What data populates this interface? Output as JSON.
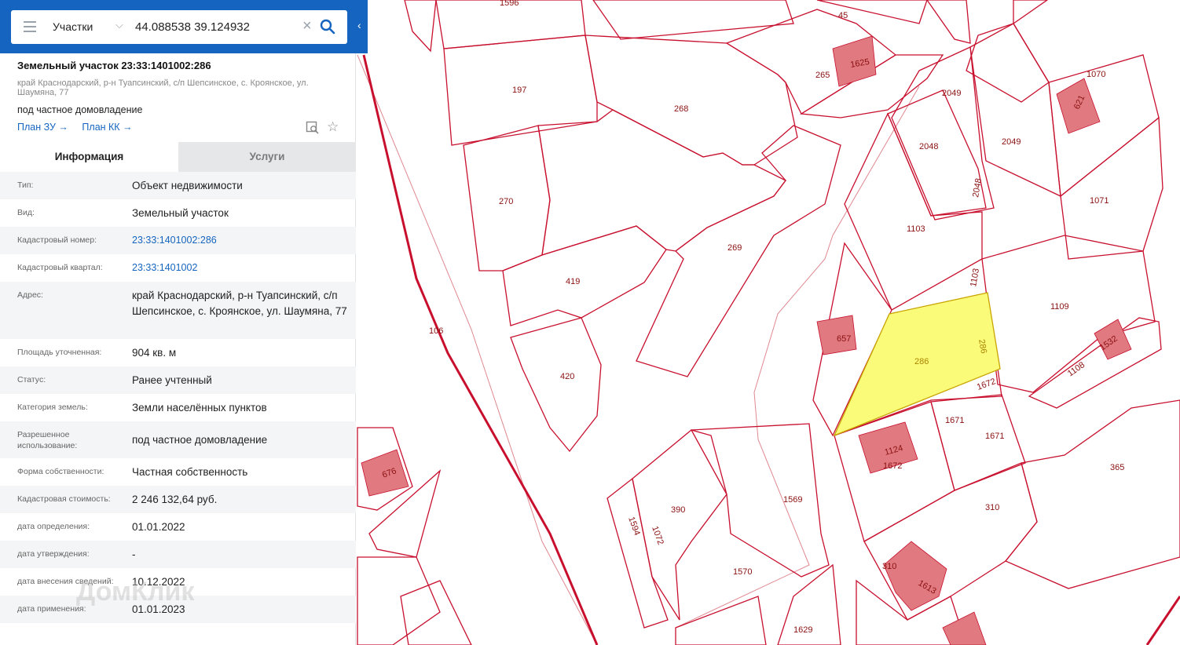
{
  "search": {
    "type": "Участки",
    "query": "44.088538 39.124932"
  },
  "object": {
    "title": "Земельный участок 23:33:1401002:286",
    "address": "край Краснодарский, р-н Туапсинский, с/п Шепсинское, с. Кроянское, ул. Шаумяна, 77",
    "purpose": "под частное домовладение",
    "links": [
      "План ЗУ →",
      "План КК →"
    ]
  },
  "tabs": [
    "Информация",
    "Услуги"
  ],
  "info": [
    {
      "key": "Тип:",
      "value": "Объект недвижимости"
    },
    {
      "key": "Вид:",
      "value": "Земельный участок"
    },
    {
      "key": "Кадастровый номер:",
      "value": "23:33:1401002:286"
    },
    {
      "key": "Кадастровый квартал:",
      "value": "23:33:1401002"
    },
    {
      "key": "Адрес:",
      "value": "край Краснодарский, р-н Туапсинский, с/п Шепсинское, с. Кроянское, ул. Шаумяна, 77"
    },
    {
      "key": "Площадь уточненная:",
      "value": "904 кв. м"
    },
    {
      "key": "Статус:",
      "value": "Ранее учтенный"
    },
    {
      "key": "Категория земель:",
      "value": "Земли населённых пунктов"
    },
    {
      "key": "Разрешенное использование:",
      "value": "под частное домовладение"
    },
    {
      "key": "Форма собственности:",
      "value": "Частная собственность"
    },
    {
      "key": "Кадастровая стоимость:",
      "value": "2 246 132,64 руб."
    },
    {
      "key": "дата определения:",
      "value": "01.01.2022"
    },
    {
      "key": "дата утверждения:",
      "value": "-"
    },
    {
      "key": "дата внесения сведений:",
      "value": "10.12.2022"
    },
    {
      "key": "дата применения:",
      "value": "01.01.2023"
    }
  ],
  "watermark": "ДомКлик",
  "map": {
    "selected_parcel": "286",
    "parcel_labels": [
      "1596",
      "45",
      "1625",
      "265",
      "1070",
      "197",
      "268",
      "2049",
      "2049",
      "621",
      "2048",
      "2048",
      "270",
      "1103",
      "1071",
      "269",
      "419",
      "1103",
      "1109",
      "286",
      "286",
      "657",
      "1532",
      "106",
      "420",
      "1108",
      "1672",
      "1671",
      "1671",
      "1124",
      "1672",
      "365",
      "676",
      "1569",
      "390",
      "1594",
      "1072",
      "310",
      "310",
      "1613",
      "1570",
      "1629"
    ],
    "colors": {
      "boundary": "#c8102e",
      "selected_fill": "#fbfb7a",
      "building": "#e07a80"
    }
  }
}
